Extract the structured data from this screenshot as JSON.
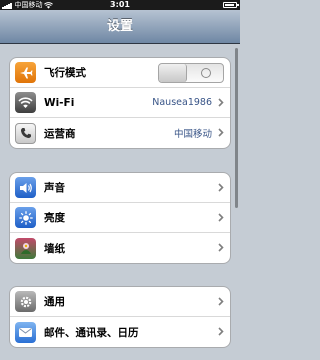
{
  "status_bar": {
    "carrier": "中国移动",
    "time": "3:01"
  },
  "nav": {
    "title": "设置"
  },
  "groups": [
    {
      "items": [
        {
          "label": "飞行模式",
          "icon": "airplane-icon",
          "toggle": "off"
        },
        {
          "label": "Wi-Fi",
          "icon": "wifi-icon",
          "value": "Nausea1986"
        },
        {
          "label": "运营商",
          "icon": "phone-icon",
          "value": "中国移动"
        }
      ]
    },
    {
      "items": [
        {
          "label": "声音",
          "icon": "speaker-icon"
        },
        {
          "label": "亮度",
          "icon": "brightness-icon"
        },
        {
          "label": "墙纸",
          "icon": "wallpaper-icon"
        }
      ]
    },
    {
      "items": [
        {
          "label": "通用",
          "icon": "gear-icon"
        },
        {
          "label": "邮件、通讯录、日历",
          "icon": "mail-icon"
        }
      ]
    }
  ],
  "colors": {
    "navbar_top": "#b6c3d2",
    "navbar_bottom": "#6f87a4",
    "background": "#c5ccd4",
    "value_text": "#385487",
    "airplane_icon_bg": "#f08a12"
  }
}
